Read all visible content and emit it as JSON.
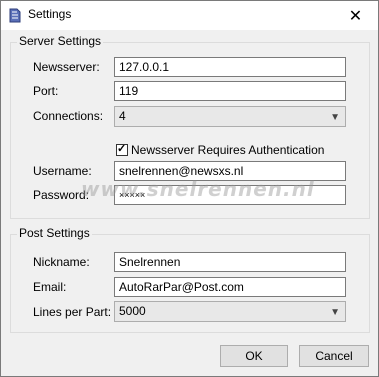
{
  "window": {
    "title": "Settings"
  },
  "server_settings": {
    "legend": "Server Settings",
    "newsserver_label": "Newsserver:",
    "newsserver_value": "127.0.0.1",
    "port_label": "Port:",
    "port_value": "119",
    "connections_label": "Connections:",
    "connections_value": "4",
    "auth_label": "Newsserver Requires Authentication",
    "auth_checked": true,
    "username_label": "Username:",
    "username_value": "snelrennen@newsxs.nl",
    "password_label": "Password:",
    "password_value": "×××××"
  },
  "post_settings": {
    "legend": "Post Settings",
    "nickname_label": "Nickname:",
    "nickname_value": "Snelrennen",
    "email_label": "Email:",
    "email_value": "AutoRarPar@Post.com",
    "lines_label": "Lines per Part:",
    "lines_value": "5000"
  },
  "buttons": {
    "ok": "OK",
    "cancel": "Cancel"
  },
  "watermark": "www.snelrennen.nl",
  "icons": {
    "app": "app-icon",
    "close": "close-icon",
    "dropdown": "chevron-down-icon",
    "check": "checkmark-icon"
  }
}
